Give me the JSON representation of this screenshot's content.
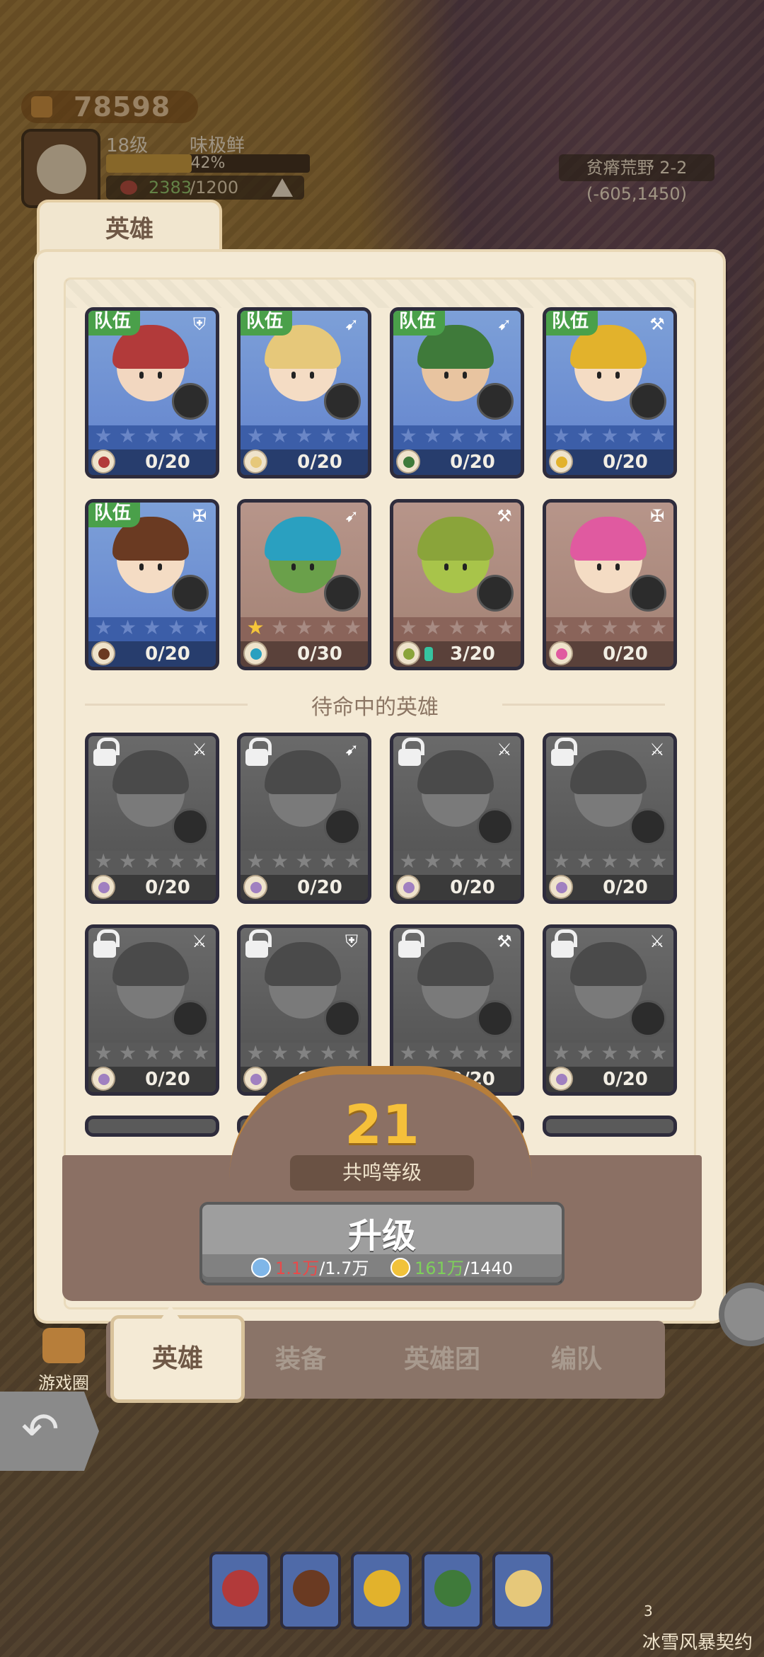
{
  "hud": {
    "gold": "78598",
    "level": "18级",
    "name": "味极鲜",
    "exp_pct": "42%",
    "exp_fraction": 0.42,
    "food_current": "2383",
    "food_max": "/1200",
    "location": "贫瘠荒野 2-2",
    "coords": "(-605,1450)"
  },
  "panel": {
    "tab_title": "英雄",
    "standby_label": "待命中的英雄",
    "team_badge": "队伍"
  },
  "heroes_team": [
    {
      "progress": "0/20",
      "class_icon": "shield-icon",
      "stars": 0,
      "skin": "#f2d7c0",
      "helm": "#b23a3a"
    },
    {
      "progress": "0/20",
      "class_icon": "bow-icon",
      "stars": 0,
      "skin": "#f4dcc4",
      "helm": "#e6c87a"
    },
    {
      "progress": "0/20",
      "class_icon": "bow-icon",
      "stars": 0,
      "skin": "#e8c4a0",
      "helm": "#3f7a3a"
    },
    {
      "progress": "0/20",
      "class_icon": "axe-icon",
      "stars": 0,
      "skin": "#f4dcc4",
      "helm": "#e2b22c"
    },
    {
      "progress": "0/20",
      "class_icon": "staff-icon",
      "stars": 0,
      "skin": "#f4dcc4",
      "helm": "#6a3a22"
    }
  ],
  "heroes_other": [
    {
      "progress": "0/30",
      "class_icon": "bow-icon",
      "stars": 1,
      "skin": "#6aa04a",
      "helm": "#2aa0c0"
    },
    {
      "progress": "3/20",
      "class_icon": "axe-icon",
      "stars": 0,
      "skin": "#a8c44a",
      "helm": "#8aa43a"
    },
    {
      "progress": "0/20",
      "class_icon": "staff-icon",
      "stars": 0,
      "skin": "#f4dcc4",
      "helm": "#e05aa0"
    }
  ],
  "heroes_locked": [
    {
      "progress": "0/20",
      "class_icon": "sword-icon"
    },
    {
      "progress": "0/20",
      "class_icon": "bow-icon"
    },
    {
      "progress": "0/20",
      "class_icon": "sword-icon"
    },
    {
      "progress": "0/20",
      "class_icon": "sword-icon"
    },
    {
      "progress": "0/20",
      "class_icon": "sword-icon"
    },
    {
      "progress": "0/20",
      "class_icon": "shield-icon"
    },
    {
      "progress": "0/20",
      "class_icon": "axe-icon"
    },
    {
      "progress": "0/20",
      "class_icon": "sword-icon"
    }
  ],
  "resonance": {
    "level": "21",
    "label": "共鸣等级",
    "upgrade_label": "升级",
    "crystal_have": "1.1万",
    "crystal_need": "/1.7万",
    "coin_have": "161万",
    "coin_need": "/1440"
  },
  "tabs": [
    "英雄",
    "装备",
    "英雄团",
    "编队"
  ],
  "side": {
    "game_circle": "游戏圈",
    "contract_count": "3",
    "contract_label": "冰雪风暴契约"
  },
  "lineup_colors": [
    "#b23a3a",
    "#6a3a22",
    "#e2b22c",
    "#3f7a3a",
    "#e6c87a"
  ]
}
